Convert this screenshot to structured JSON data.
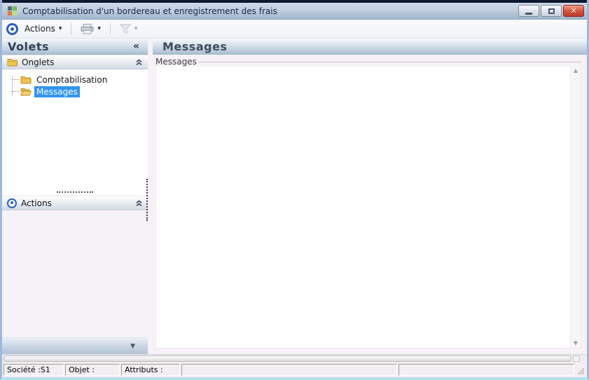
{
  "window": {
    "title": "Comptabilisation d'un bordereau et enregistrement des frais"
  },
  "icons": {
    "collapse_left_glyph": "«",
    "caret_down_glyph": "▾",
    "scroll_up_glyph": "▲",
    "scroll_down_glyph": "▼",
    "panel_down_glyph": "▼",
    "close_glyph": "✕"
  },
  "toolbar": {
    "actions_label": "Actions"
  },
  "left_panel": {
    "header": {
      "title": "Volets"
    },
    "sections": [
      {
        "title": "Onglets"
      },
      {
        "title": "Actions"
      }
    ],
    "tree": [
      {
        "label": "Comptabilisation",
        "selected": false
      },
      {
        "label": "Messages",
        "selected": true
      }
    ]
  },
  "main": {
    "header_title": "Messages",
    "groupbox_label": "Messages"
  },
  "statusbar": {
    "cells": [
      {
        "label": "Société :S1"
      },
      {
        "label": "Objet :"
      },
      {
        "label": "Attributs :"
      },
      {
        "label": ""
      },
      {
        "label": ""
      }
    ]
  },
  "colors": {
    "selection_blue": "#2f95f0",
    "header_text": "#31415c",
    "close_red": "#c33a28",
    "folder_yellow": "#f2c34f",
    "target_blue": "#2a5ec0"
  }
}
